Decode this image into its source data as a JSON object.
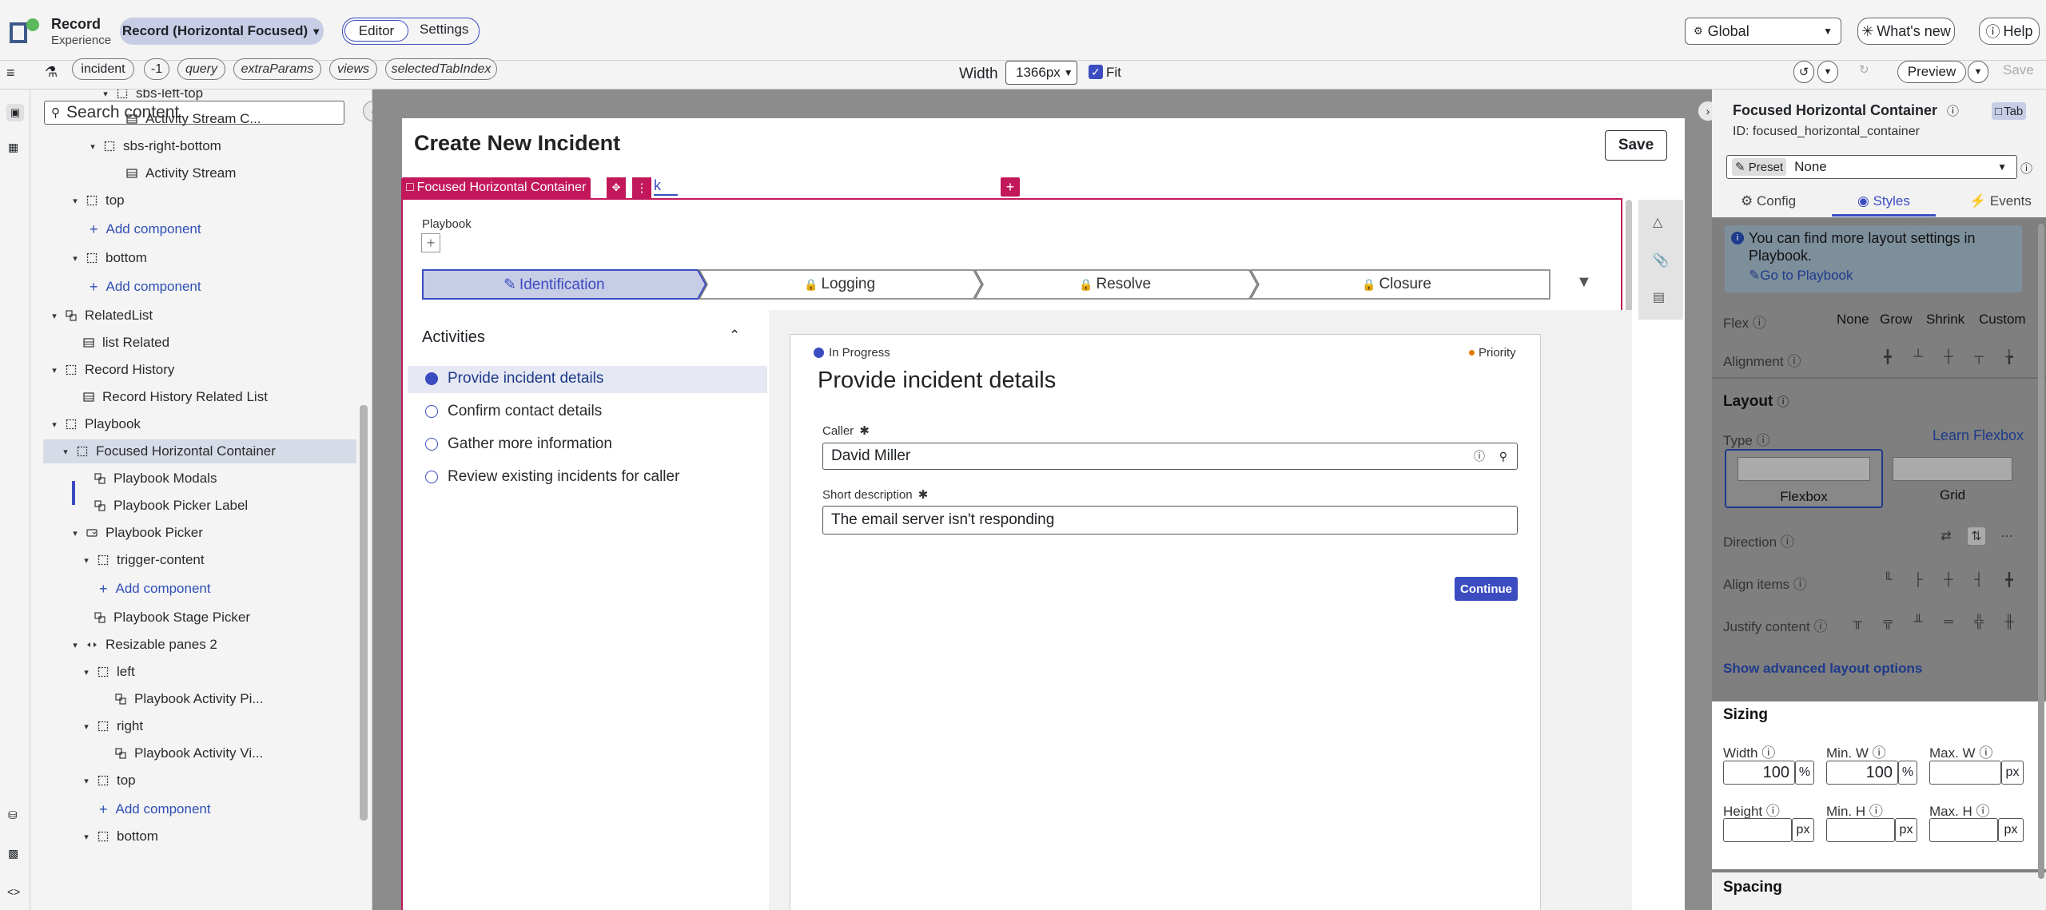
{
  "app": {
    "name": "Record",
    "subtitle": "Experience",
    "page_selector": "Record (Horizontal Focused)"
  },
  "top_tabs": {
    "editor": "Editor",
    "settings": "Settings"
  },
  "top_right": {
    "scope": "Global",
    "whats_new": "What's new",
    "help": "Help"
  },
  "toolbar": {
    "params": [
      "incident",
      "-1",
      "query",
      "extraParams",
      "views",
      "selectedTabIndex"
    ],
    "width_label": "Width",
    "width_value": "1366px",
    "fit_label": "Fit",
    "preview": "Preview",
    "save": "Save"
  },
  "tree": {
    "search_placeholder": "Search content",
    "items": [
      {
        "label": "sbs-left-top"
      },
      {
        "label": "Activity Stream C..."
      },
      {
        "label": "sbs-right-bottom"
      },
      {
        "label": "Activity Stream"
      },
      {
        "label": "top"
      },
      {
        "label": "Add component"
      },
      {
        "label": "bottom"
      },
      {
        "label": "Add component"
      },
      {
        "label": "RelatedList"
      },
      {
        "label": "list Related"
      },
      {
        "label": "Record History"
      },
      {
        "label": "Record History Related List"
      },
      {
        "label": "Playbook"
      },
      {
        "label": "Focused Horizontal Container"
      },
      {
        "label": "Playbook Modals"
      },
      {
        "label": "Playbook Picker Label"
      },
      {
        "label": "Playbook Picker"
      },
      {
        "label": "trigger-content"
      },
      {
        "label": "Add component"
      },
      {
        "label": "Playbook Stage Picker"
      },
      {
        "label": "Resizable panes 2"
      },
      {
        "label": "left"
      },
      {
        "label": "Playbook Activity Pi..."
      },
      {
        "label": "right"
      },
      {
        "label": "Playbook Activity Vi..."
      },
      {
        "label": "top"
      },
      {
        "label": "Add component"
      },
      {
        "label": "bottom"
      }
    ]
  },
  "canvas": {
    "page_title": "Create New Incident",
    "save": "Save",
    "selection_label": "Focused Horizontal Container",
    "tab_fragment": "k",
    "playbook_label": "Playbook",
    "stages": [
      "Identification",
      "Logging",
      "Resolve",
      "Closure"
    ],
    "activities_title": "Activities",
    "activities": [
      "Provide incident details",
      "Confirm contact details",
      "Gather more information",
      "Review existing incidents for caller"
    ],
    "card": {
      "status": "In Progress",
      "priority": "Priority",
      "title": "Provide incident details",
      "caller_label": "Caller",
      "caller_value": "David Miller",
      "short_desc_label": "Short description",
      "short_desc_value": "The email server isn't responding",
      "continue": "Continue"
    }
  },
  "panel": {
    "title": "Focused Horizontal Container",
    "tab_badge": "Tab",
    "id_text": "ID: focused_horizontal_container",
    "preset_label": "Preset",
    "preset_value": "None",
    "tabs": [
      "Config",
      "Styles",
      "Events"
    ],
    "info_text": "You can find more layout settings in Playbook.",
    "info_link": "Go to Playbook",
    "flex_label": "Flex",
    "flex_options": [
      "None",
      "Grow",
      "Shrink",
      "Custom"
    ],
    "alignment_label": "Alignment",
    "layout_title": "Layout",
    "type_label": "Type",
    "learn_link": "Learn Flexbox",
    "type_options": [
      "Flexbox",
      "Grid"
    ],
    "direction_label": "Direction",
    "align_items_label": "Align items",
    "justify_label": "Justify content",
    "advanced_link": "Show advanced layout options",
    "sizing_title": "Sizing",
    "width_label": "Width",
    "min_w_label": "Min. W",
    "max_w_label": "Max. W",
    "width_value": "100",
    "min_w_value": "100",
    "height_label": "Height",
    "min_h_label": "Min. H",
    "max_h_label": "Max. H",
    "unit_pct": "%",
    "unit_px": "px",
    "spacing_title": "Spacing"
  },
  "colors": {
    "accent": "#3b4cc0",
    "selection": "#c2185b",
    "info_bg": "#c9dbe8"
  }
}
